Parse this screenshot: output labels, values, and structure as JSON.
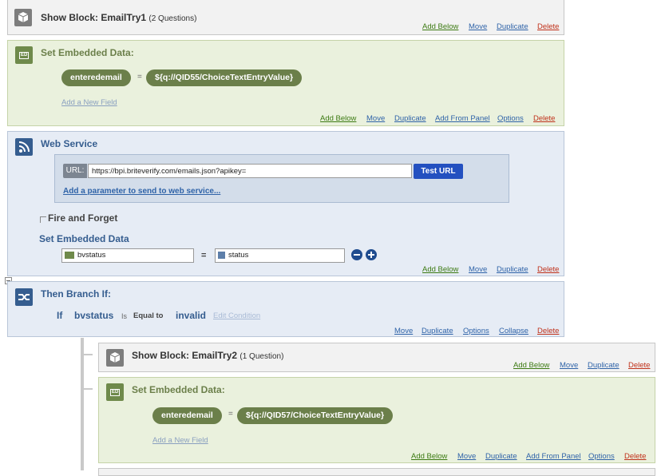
{
  "block1": {
    "title": "Show Block: EmailTry1",
    "subtitle": "(2 Questions)",
    "actions": [
      "Add Below",
      "Move",
      "Duplicate",
      "Delete"
    ]
  },
  "embed1": {
    "title": "Set Embedded Data:",
    "field_name": "enteredemail",
    "equals": "=",
    "field_value": "${q://QID55/ChoiceTextEntryValue}",
    "add_field": "Add a New Field",
    "actions": [
      "Add Below",
      "Move",
      "Duplicate",
      "Add From Panel",
      "Options",
      "Delete"
    ]
  },
  "webservice": {
    "title": "Web Service",
    "url_label": "URL:",
    "url_value": "https://bpi.briteverify.com/emails.json?apikey=",
    "test_button": "Test URL",
    "add_param": "Add a parameter to send to web service...",
    "fire_forget": "Fire and Forget",
    "set_embedded": "Set Embedded Data",
    "var_name": "bvstatus",
    "equals": "=",
    "var_value": "status",
    "actions": [
      "Add Below",
      "Move",
      "Duplicate",
      "Delete"
    ]
  },
  "branch": {
    "title": "Then Branch If:",
    "if_word": "If",
    "field": "bvstatus",
    "is_word": "Is",
    "operator": "Equal to",
    "value": "invalid",
    "edit_condition": "Edit Condition",
    "actions": [
      "Move",
      "Duplicate",
      "Options",
      "Collapse",
      "Delete"
    ]
  },
  "block2": {
    "title": "Show Block: EmailTry2",
    "subtitle": "(1 Question)",
    "actions": [
      "Add Below",
      "Move",
      "Duplicate",
      "Delete"
    ]
  },
  "embed2": {
    "title": "Set Embedded Data:",
    "field_name": "enteredemail",
    "equals": "=",
    "field_value": "${q://QID57/ChoiceTextEntryValue}",
    "add_field": "Add a New Field",
    "actions": [
      "Add Below",
      "Move",
      "Duplicate",
      "Add From Panel",
      "Options",
      "Delete"
    ]
  },
  "icons": {
    "block": "cube-icon",
    "embedded": "embedded-data-icon",
    "webservice": "rss-feed-icon",
    "branch": "branch-arrow-icon",
    "remove": "minus-circle-icon",
    "add": "plus-circle-icon"
  },
  "colors": {
    "action_green": "#3c7a12",
    "action_blue": "#2f63a8",
    "action_red": "#c0311a",
    "embed_bg": "#eaf1dd",
    "service_bg": "#e6ecf5",
    "pill": "#6b7f4a",
    "test_button": "#2350c0"
  }
}
